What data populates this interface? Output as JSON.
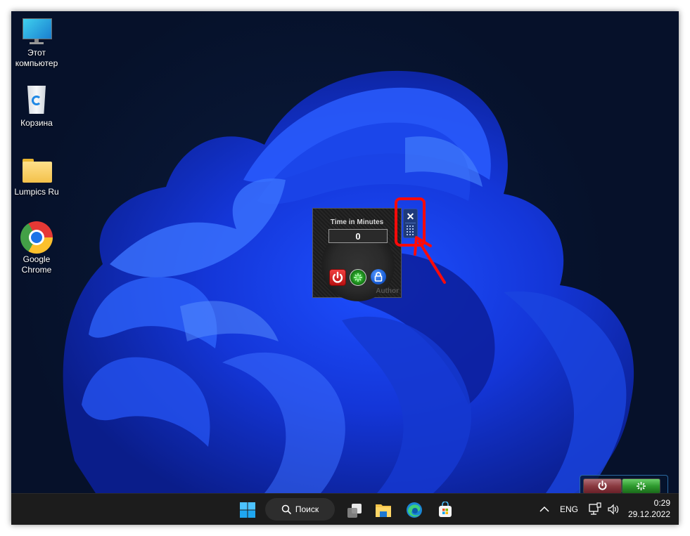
{
  "desktop": {
    "icons": [
      {
        "name": "this-pc",
        "label": "Этот компьютер",
        "icon": "monitor-icon"
      },
      {
        "name": "recycle-bin",
        "label": "Корзина",
        "icon": "recycle-bin-icon"
      },
      {
        "name": "lumpics-folder",
        "label": "Lumpics Ru",
        "icon": "folder-icon"
      },
      {
        "name": "google-chrome",
        "label": "Google Chrome",
        "icon": "chrome-icon"
      }
    ]
  },
  "widget": {
    "title": "Time in Minutes",
    "time_value": "0",
    "buttons": [
      {
        "name": "shutdown",
        "icon": "power-icon",
        "color": "#d42020"
      },
      {
        "name": "restart",
        "icon": "restart-icon",
        "color": "#1b8a1b"
      },
      {
        "name": "lock",
        "icon": "lock-icon",
        "color": "#1a5fd6"
      }
    ],
    "author_label": "Author",
    "close_glyph": "✕",
    "side_controls": [
      "close-icon",
      "drag-grip-icon"
    ]
  },
  "mini_gadget": {
    "buttons": [
      {
        "name": "power",
        "icon": "power-icon",
        "color": "#8a3a40"
      },
      {
        "name": "restart",
        "icon": "restart-icon",
        "color": "#2e9a2e"
      }
    ]
  },
  "annotation": {
    "color": "#ff0a0a"
  },
  "taskbar": {
    "search_label": "Поиск",
    "apps": [
      "start-icon",
      "task-view-icon",
      "file-explorer-icon",
      "edge-icon",
      "store-icon"
    ],
    "tray": {
      "language": "ENG",
      "time": "0:29",
      "date": "29.12.2022"
    }
  }
}
